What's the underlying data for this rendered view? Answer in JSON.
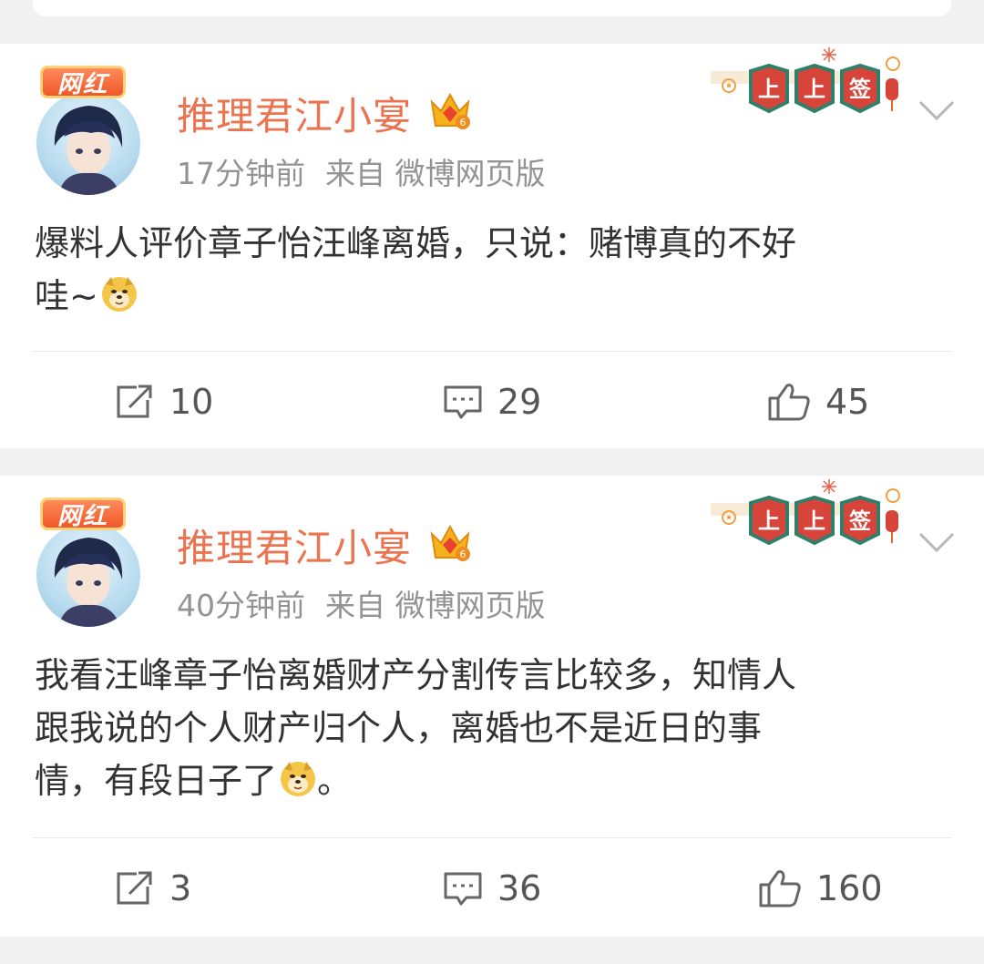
{
  "posts": [
    {
      "badge": "网红",
      "username": "推理君江小宴",
      "crown_level": "6",
      "time": "17分钟前",
      "source": "来自 微博网页版",
      "fortune": [
        "上",
        "上",
        "签"
      ],
      "content_lines": [
        "爆料人评价章子怡汪峰离婚，只说：赌博真的不好",
        "哇~"
      ],
      "reposts": "10",
      "comments": "29",
      "likes": "45"
    },
    {
      "badge": "网红",
      "username": "推理君江小宴",
      "crown_level": "6",
      "time": "40分钟前",
      "source": "来自 微博网页版",
      "fortune": [
        "上",
        "上",
        "签"
      ],
      "content_lines": [
        "我看汪峰章子怡离婚财产分割传言比较多，知情人",
        "跟我说的个人财产归个人，离婚也不是近日的事",
        "情，有段日子了"
      ],
      "content_tail": "。",
      "reposts": "3",
      "comments": "36",
      "likes": "160"
    }
  ],
  "colors": {
    "username": "#eb7350",
    "meta": "#939393",
    "text": "#333333",
    "page_bg": "#f1f1f1",
    "card_bg": "#ffffff"
  }
}
